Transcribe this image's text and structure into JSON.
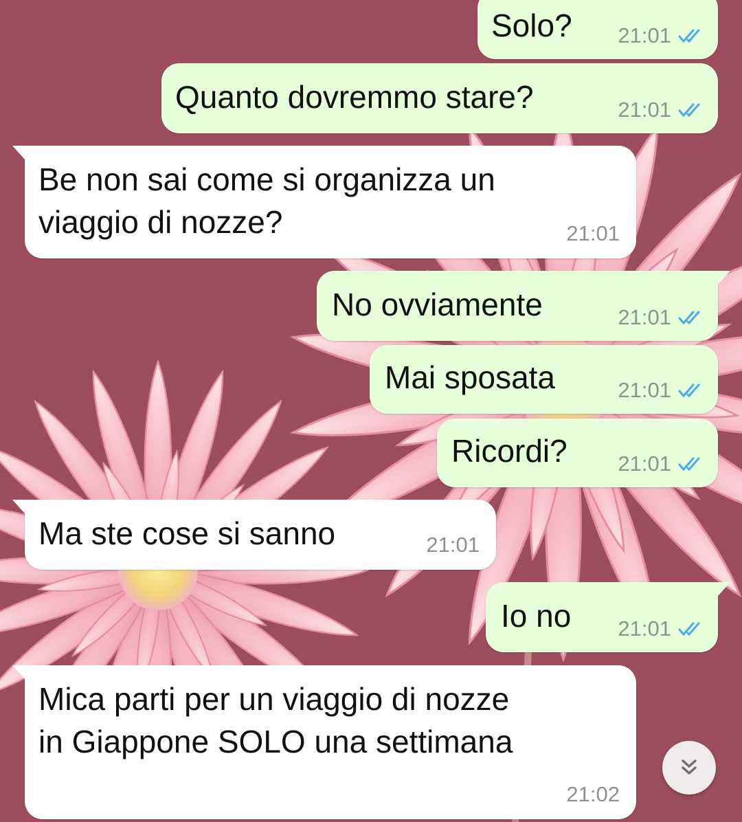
{
  "chat": {
    "messages": [
      {
        "text": "Solo?",
        "time": "21:01",
        "direction": "outgoing",
        "status": "read"
      },
      {
        "text": "Quanto dovremmo stare?",
        "time": "21:01",
        "direction": "outgoing",
        "status": "read"
      },
      {
        "text": "Be non sai come si organizza un\nviaggio di nozze?",
        "time": "21:01",
        "direction": "incoming"
      },
      {
        "text": "No ovviamente",
        "time": "21:01",
        "direction": "outgoing",
        "status": "read"
      },
      {
        "text": "Mai sposata",
        "time": "21:01",
        "direction": "outgoing",
        "status": "read"
      },
      {
        "text": "Ricordi?",
        "time": "21:01",
        "direction": "outgoing",
        "status": "read"
      },
      {
        "text": "Ma ste cose si sanno",
        "time": "21:01",
        "direction": "incoming"
      },
      {
        "text": "Io no",
        "time": "21:01",
        "direction": "outgoing",
        "status": "read"
      },
      {
        "text": "Mica parti per un viaggio di nozze\nin Giappone SOLO una settimana",
        "time": "21:02",
        "direction": "incoming"
      }
    ]
  },
  "icons": {
    "read_receipt": "double-check-icon",
    "scroll_down": "double-chevron-down-icon"
  },
  "colors": {
    "wallpaper": "#9c4e5e",
    "outgoing_bubble": "#e6ffda",
    "incoming_bubble": "#ffffff",
    "read_tick": "#4fa8e8",
    "timestamp": "#8c928c"
  }
}
